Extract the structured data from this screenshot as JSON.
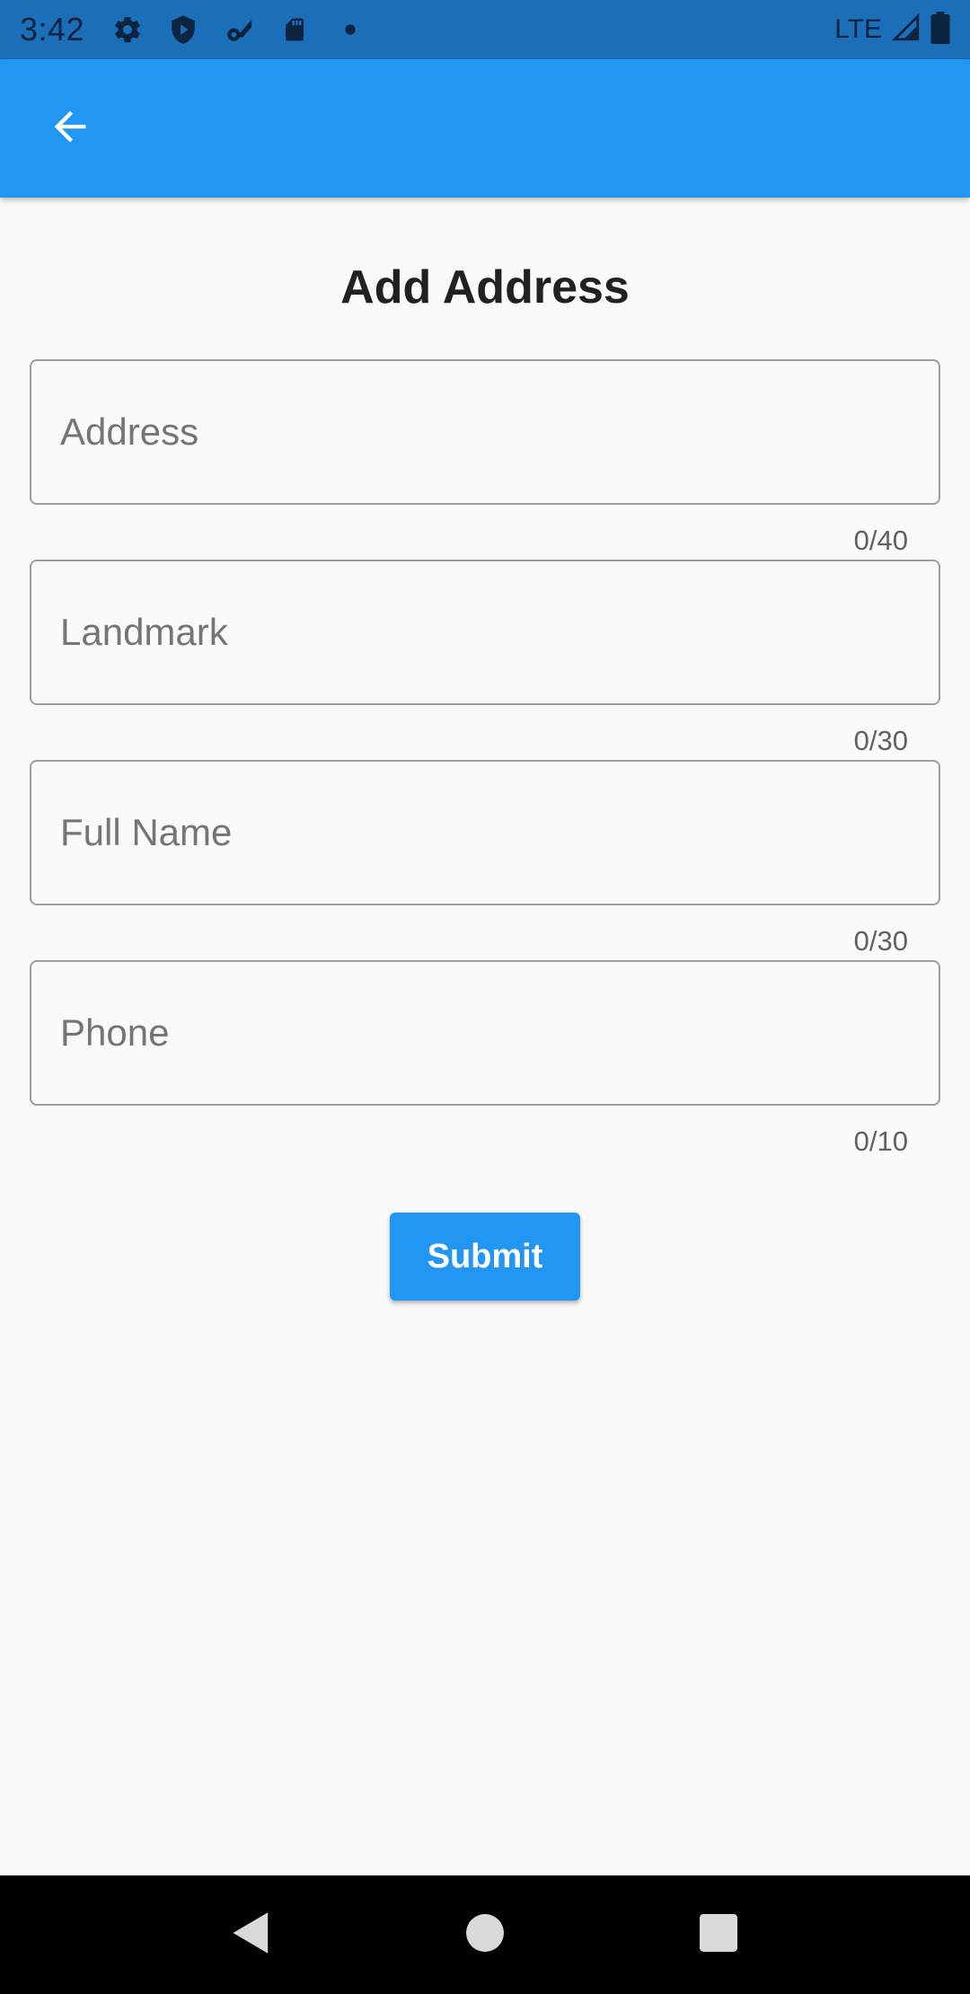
{
  "status_bar": {
    "time": "3:42",
    "network": "LTE",
    "icons": [
      "settings-icon",
      "shield-play-icon",
      "wifi-settings-icon",
      "sd-card-icon",
      "dot-icon",
      "signal-icon",
      "battery-icon"
    ]
  },
  "app_bar": {
    "back_icon": "arrow-back-icon",
    "color": "#2196f3"
  },
  "page": {
    "title": "Add Address"
  },
  "form": {
    "fields": [
      {
        "placeholder": "Address",
        "value": "",
        "counter": "0/40"
      },
      {
        "placeholder": "Landmark",
        "value": "",
        "counter": "0/30"
      },
      {
        "placeholder": "Full Name",
        "value": "",
        "counter": "0/30"
      },
      {
        "placeholder": "Phone",
        "value": "",
        "counter": "0/10"
      }
    ],
    "submit_label": "Submit"
  },
  "nav_bar": {
    "icons": [
      "nav-back-icon",
      "nav-home-icon",
      "nav-recents-icon"
    ]
  },
  "colors": {
    "primary": "#2196f3",
    "status_bar": "#1b6fb8",
    "background": "#fafafa"
  }
}
